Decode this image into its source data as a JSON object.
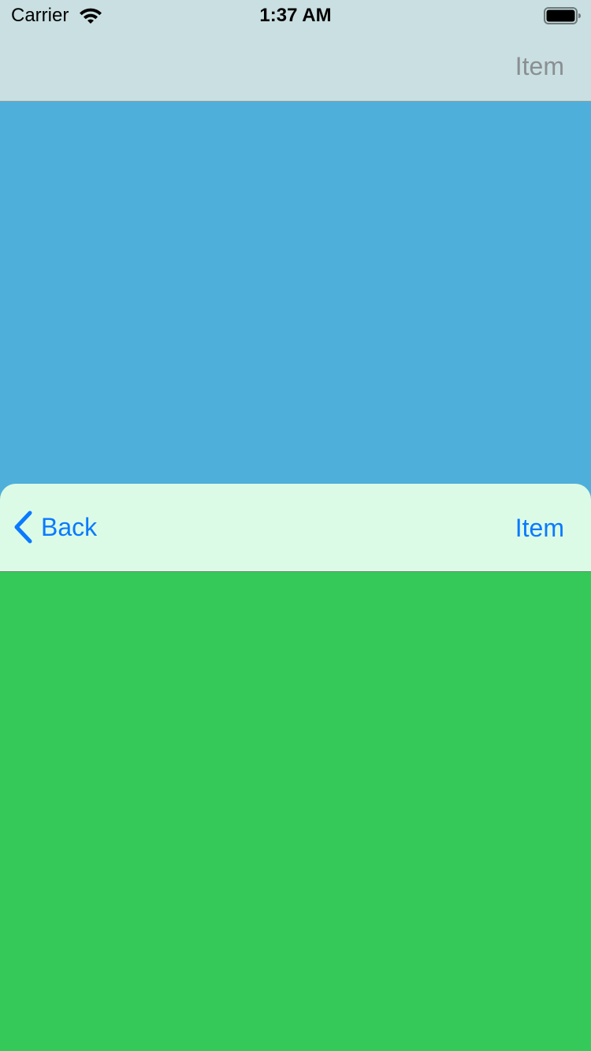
{
  "status_bar": {
    "carrier": "Carrier",
    "time": "1:37 AM",
    "wifi_icon": "wifi-icon",
    "battery_icon": "battery-icon"
  },
  "top_nav": {
    "item_label": "Item",
    "item_color": "#8a8f92",
    "background": "#c9dfe1"
  },
  "content": {
    "blue_color": "#4fafdb",
    "green_color": "#35c95a"
  },
  "nav_bar": {
    "back_label": "Back",
    "back_icon": "chevron-left-icon",
    "item_label": "Item",
    "tint_color": "#0a7aff",
    "background": "#dcfbe6"
  }
}
